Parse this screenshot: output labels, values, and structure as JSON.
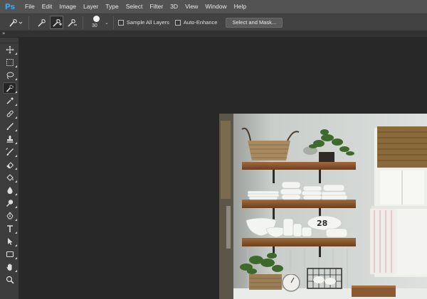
{
  "app": {
    "logo": "Ps",
    "menu": [
      "File",
      "Edit",
      "Image",
      "Layer",
      "Type",
      "Select",
      "Filter",
      "3D",
      "View",
      "Window",
      "Help"
    ]
  },
  "options": {
    "brush_size": "30",
    "sample_all_layers": {
      "label": "Sample All Layers",
      "checked": false
    },
    "auto_enhance": {
      "label": "Auto-Enhance",
      "checked": false
    },
    "select_mask_label": "Select and Mask..."
  },
  "panel": {
    "collapse_glyph": "»"
  },
  "tools": [
    "move-tool",
    "marquee-tool",
    "lasso-tool",
    "quick-selection-tool",
    "eyedropper-tool",
    "spot-healing-tool",
    "brush-tool",
    "clone-stamp-tool",
    "history-brush-tool",
    "eraser-tool",
    "paint-bucket-tool",
    "blur-tool",
    "dodge-tool",
    "pen-tool",
    "type-tool",
    "path-selection-tool",
    "rectangle-tool",
    "hand-tool",
    "zoom-tool"
  ],
  "colors": {
    "menubar": "#535353",
    "optionsbar": "#424242",
    "toolbar": "#3c3c3c",
    "workspace": "#282828",
    "logo": "#31a8ff"
  }
}
